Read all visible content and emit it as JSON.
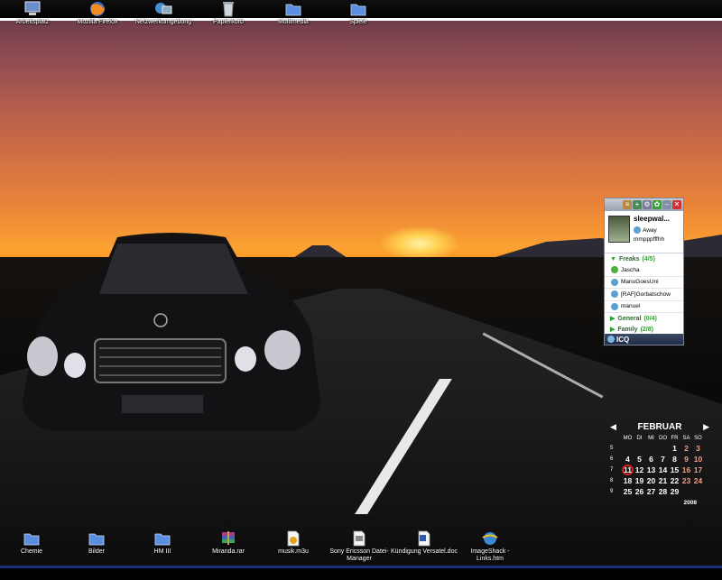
{
  "top_icons": [
    {
      "label": "Arbeitsplatz",
      "icon": "computer-icon"
    },
    {
      "label": "Mozilla Firefox",
      "icon": "firefox-icon"
    },
    {
      "label": "Netzwerkumgebung",
      "icon": "network-icon"
    },
    {
      "label": "Papierkorb",
      "icon": "recycle-bin-icon"
    },
    {
      "label": "Multimedia",
      "icon": "folder-icon"
    },
    {
      "label": "Spiele",
      "icon": "folder-icon"
    }
  ],
  "bottom_icons": [
    {
      "label": "Chemie",
      "icon": "folder-icon"
    },
    {
      "label": "Bilder",
      "icon": "folder-icon"
    },
    {
      "label": "HM III",
      "icon": "folder-icon"
    },
    {
      "label": "Miranda.rar",
      "icon": "rar-archive-icon"
    },
    {
      "label": "musik.m3u",
      "icon": "playlist-icon"
    },
    {
      "label": "Sony Ericsson Datei-Manager",
      "icon": "app-shortcut-icon"
    },
    {
      "label": "Kündigung Versatel.doc",
      "icon": "word-document-icon"
    },
    {
      "label": "ImageShack - Links.htm",
      "icon": "html-file-icon"
    }
  ],
  "icq": {
    "username": "sleepwal...",
    "status": "Away",
    "status_message": "mmpppfffhh",
    "footer": "ICQ",
    "groups": [
      {
        "name": "Freaks",
        "count": "(4/5)",
        "expanded": true,
        "contacts": [
          "Jascha",
          "ManuGoesUni",
          "[RAF]Gorbatschow",
          "manuel"
        ]
      },
      {
        "name": "General",
        "count": "(0/4)",
        "expanded": false,
        "contacts": []
      },
      {
        "name": "Family",
        "count": "(2/8)",
        "expanded": false,
        "contacts": []
      }
    ]
  },
  "calendar": {
    "month": "FEBRUAR",
    "year": "2008",
    "day_headers": [
      "MO",
      "DI",
      "MI",
      "DO",
      "FR",
      "SA",
      "SO"
    ],
    "weeks": [
      {
        "week": "5",
        "days": [
          "",
          "",
          "",
          "",
          "1",
          "2",
          "3"
        ]
      },
      {
        "week": "6",
        "days": [
          "4",
          "5",
          "6",
          "7",
          "8",
          "9",
          "10"
        ]
      },
      {
        "week": "7",
        "days": [
          "11",
          "12",
          "13",
          "14",
          "15",
          "16",
          "17"
        ]
      },
      {
        "week": "8",
        "days": [
          "18",
          "19",
          "20",
          "21",
          "22",
          "23",
          "24"
        ]
      },
      {
        "week": "9",
        "days": [
          "25",
          "26",
          "27",
          "28",
          "29",
          "",
          ""
        ]
      }
    ],
    "today": "11",
    "weekend_color": "#f0a080",
    "today_ring_color": "#d02020"
  }
}
